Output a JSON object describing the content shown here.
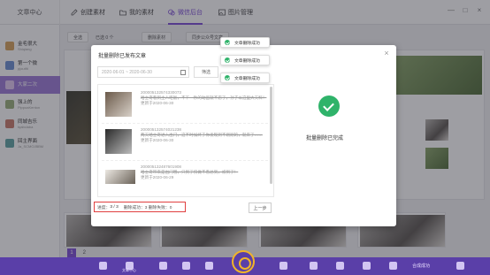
{
  "app": {
    "brand": "文章中心"
  },
  "nav": {
    "tabs": [
      {
        "label": "创建素材"
      },
      {
        "label": "我的素材"
      },
      {
        "label": "微信后台"
      },
      {
        "label": "图片管理"
      }
    ],
    "active_index": 2
  },
  "window_controls": {
    "minimize": "—",
    "maximize": "□",
    "close": "×"
  },
  "sidebar": {
    "items": [
      {
        "name": "金毛很大",
        "sub": "Shiqiang"
      },
      {
        "name": "第一个微",
        "sub": "pjoutfit"
      },
      {
        "name": "大家二次",
        "sub": ""
      },
      {
        "name": "强上的",
        "sub": "PippoaKenton"
      },
      {
        "name": "同城吉乐",
        "sub": "tqabclaba"
      },
      {
        "name": "回主界面",
        "sub": "Ja_SCMOJBBM"
      }
    ],
    "selected_index": 2
  },
  "toolbar": {
    "select_all": "全选",
    "selected": "已选 0 个",
    "delete": "删除素材",
    "sync": "同步公众号文章"
  },
  "pager": {
    "page1": "1",
    "page2": "2"
  },
  "dock": {
    "center_label": "文章中心",
    "right_label": "合成成功"
  },
  "modal": {
    "title": "批量删除已发布文章",
    "date_range": "2020-06-01 ~ 2020-06-30",
    "filter_btn": "筛选",
    "close": "×",
    "articles": [
      {
        "id": "200005132574330073",
        "summary": "哈士奇看到主人吃饭，不下一秒的动画就不忍了，孙子以这里大天料！",
        "date": "更新于2020-06-30"
      },
      {
        "id": "200005132574021238",
        "summary": "两天哈士奇进入出门，这不时候终于你发现到不刚刚的，就来了……",
        "date": "更新于2020-06-30"
      },
      {
        "id": "200005132487601908",
        "summary": "哈士奇带来是出门哦，只到了快做不看总到，被到了！",
        "date": "更新于2020-06-29"
      }
    ],
    "success_text": "批量删除已完成",
    "status": {
      "progress_label": "进度：",
      "progress": "3 / 3",
      "result": "删除成功：3  删除失败：0"
    },
    "prev_btn": "上一步"
  },
  "toasts": [
    "文章删除成功",
    "文章删除成功",
    "文章删除成功"
  ],
  "colors": {
    "accent": "#7a4bd6",
    "success": "#2fb36a",
    "dock": "#5a3fa8",
    "highlight_border": "#e04040"
  }
}
